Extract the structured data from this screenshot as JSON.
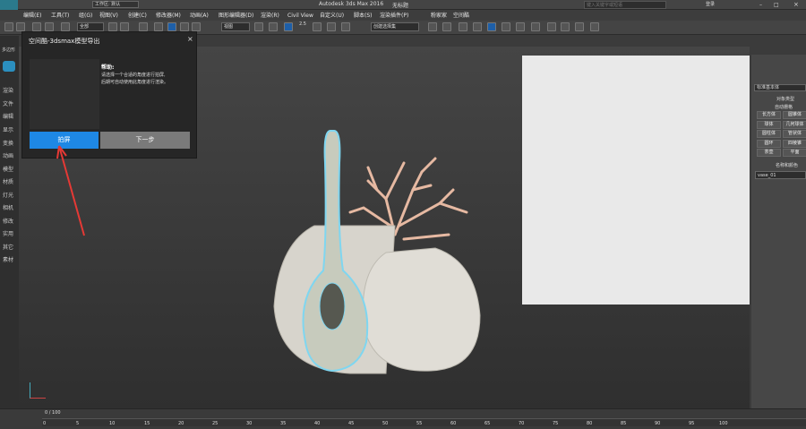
{
  "title": {
    "app": "Autodesk 3ds Max 2016",
    "doc": "无标题",
    "workspace": "工作区: 默认"
  },
  "search": {
    "placeholder": "键入关键字或短语"
  },
  "login": "登录",
  "menu": [
    "编辑(E)",
    "工具(T)",
    "组(G)",
    "视图(V)",
    "创建(C)",
    "修改器(M)",
    "动画(A)",
    "图形编辑器(D)",
    "渲染(R)",
    "Civil View",
    "自定义(U)",
    "脚本(S)",
    "渲染插件(P)",
    "粉家家",
    "空间酷"
  ],
  "toolbar": {
    "selection_set": "全部",
    "viewport_type": "视图",
    "snap_value": "2.5",
    "named_set": "创建选择集"
  },
  "left_panel": {
    "tab": "多边形",
    "items": [
      "渲染",
      "文件",
      "编辑",
      "显示",
      "变换",
      "动画",
      "模型",
      "材质",
      "灯光",
      "相机",
      "修改",
      "实用",
      "其它",
      "素材"
    ]
  },
  "dialog": {
    "title": "空间酷-3dsmax模型导出",
    "help_title": "帮助:",
    "help_lines": [
      "请选择一个合适的角度进行拍屏,",
      "后期可自动使用此角度进行渲染。"
    ],
    "btn_capture": "拍屏",
    "btn_next": "下一步"
  },
  "right_panel": {
    "category": "标准基本体",
    "rollout1": "对象类型",
    "auto_grid": "自动栅格",
    "buttons": [
      "长方体",
      "圆锥体",
      "球体",
      "几何球体",
      "圆柱体",
      "管状体",
      "圆环",
      "四棱锥",
      "茶壶",
      "平面"
    ],
    "rollout2": "名称和颜色",
    "object_name": "vase_01"
  },
  "timeline": {
    "frame": "0 / 100",
    "ticks": [
      "0",
      "5",
      "10",
      "15",
      "20",
      "25",
      "30",
      "35",
      "40",
      "45",
      "50",
      "55",
      "60",
      "65",
      "70",
      "75",
      "80",
      "85",
      "90",
      "95",
      "100"
    ]
  },
  "colors": {
    "accent": "#1e88e5",
    "bg": "#3b3b3b",
    "panel": "#474747"
  }
}
